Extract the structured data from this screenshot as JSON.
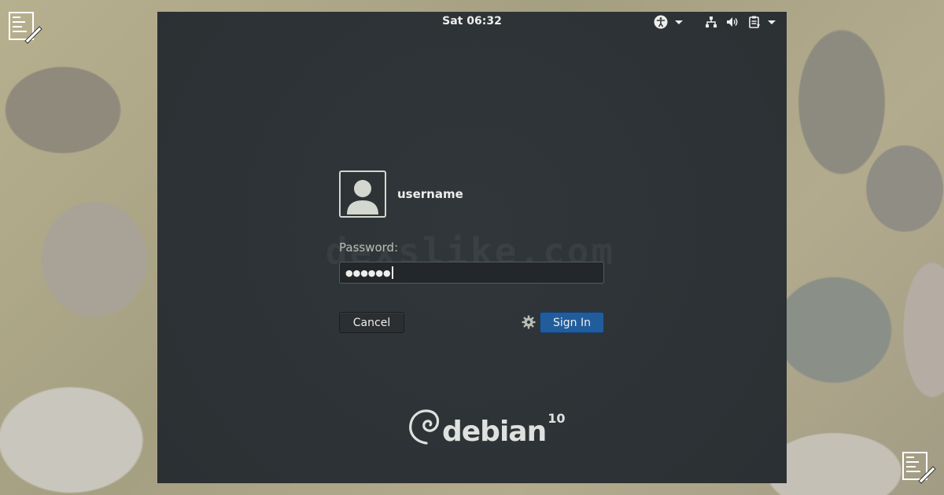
{
  "topbar": {
    "clock": "Sat 06:32",
    "icons": [
      "accessibility-icon",
      "dropdown-arrow-icon",
      "network-icon",
      "volume-icon",
      "clipboard-icon",
      "dropdown-arrow-icon"
    ]
  },
  "watermark": "dexslike.com",
  "login": {
    "username": "username",
    "password_label": "Password:",
    "password_mask": "●●●●●●",
    "cancel_label": "Cancel",
    "signin_label": "Sign In"
  },
  "brand": {
    "name": "debian",
    "version": "10"
  },
  "colors": {
    "panel": "#2e3436",
    "accent": "#215d9c",
    "text": "#eeeeec"
  }
}
